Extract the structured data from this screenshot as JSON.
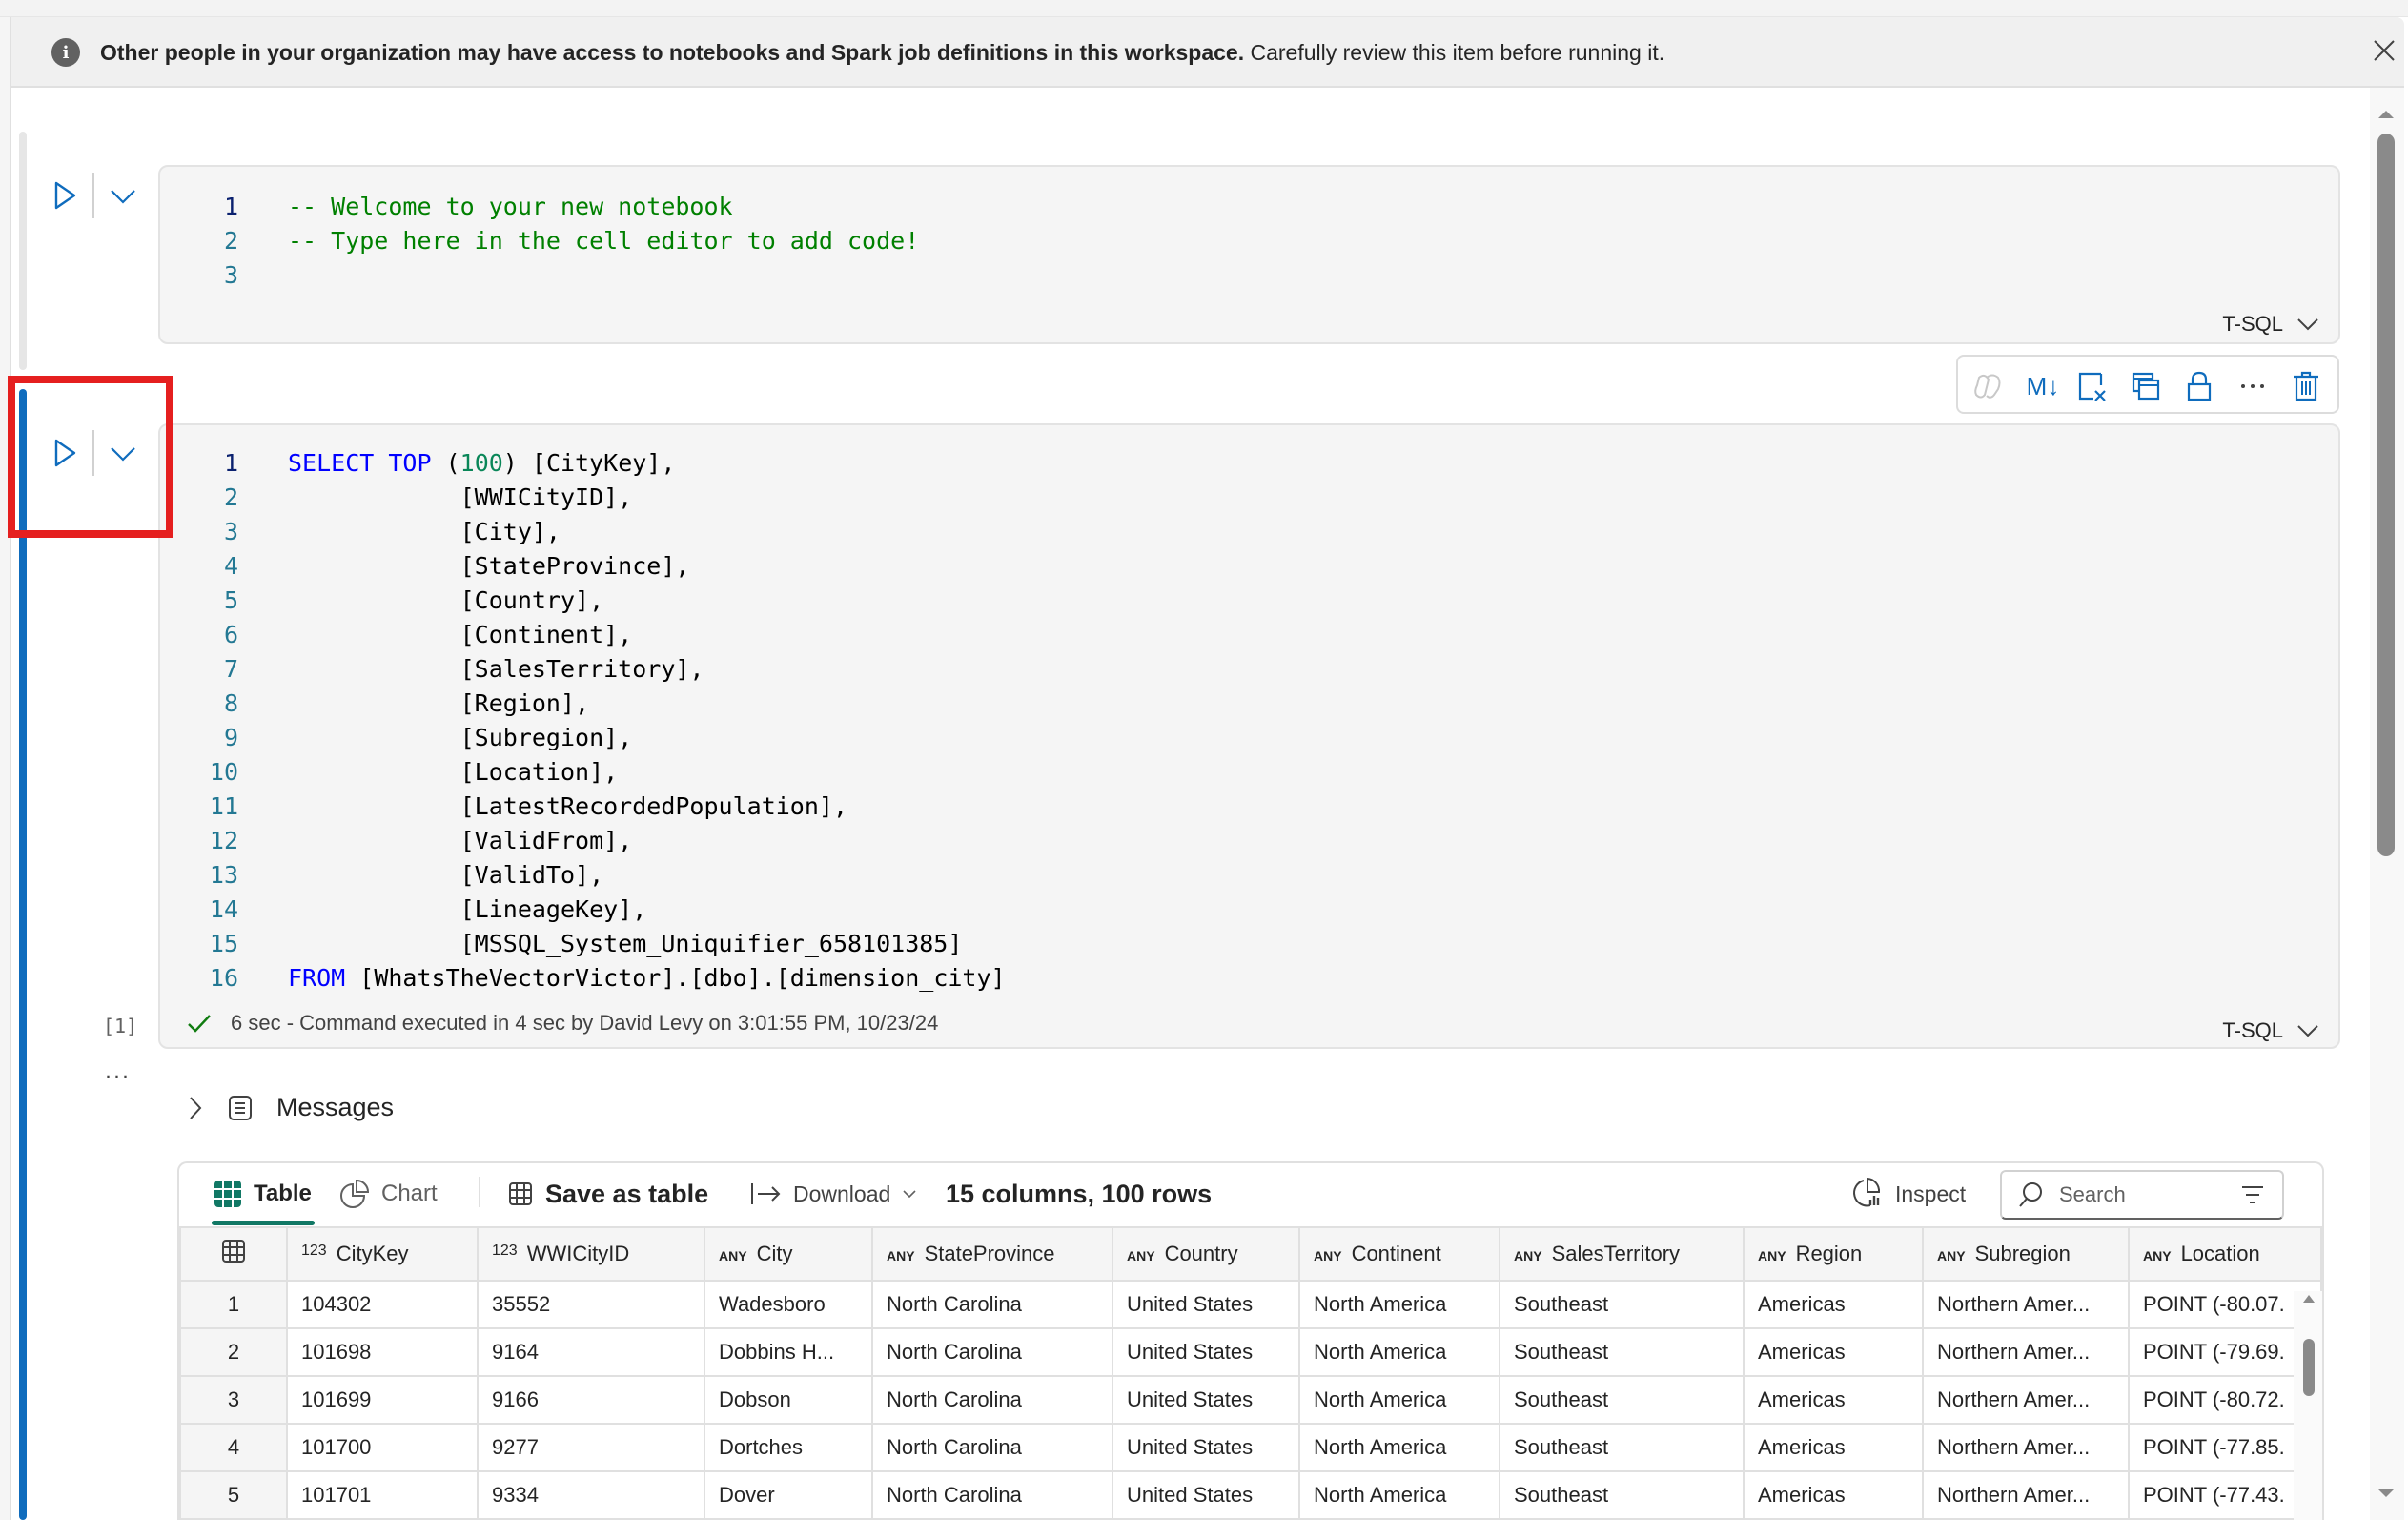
{
  "banner": {
    "bold_text": "Other people in your organization may have access to notebooks and Spark job definitions in this workspace.",
    "normal_text": " Carefully review this item before running it.",
    "icon": "info-icon",
    "close_icon": "close-icon"
  },
  "cells": [
    {
      "language": "T-SQL",
      "lines": [
        {
          "n": "1",
          "tokens": [
            {
              "t": "-- Welcome to your new notebook",
              "c": "comment"
            }
          ]
        },
        {
          "n": "2",
          "tokens": [
            {
              "t": "-- Type here in the cell editor to add code!",
              "c": "comment"
            }
          ]
        },
        {
          "n": "3",
          "tokens": []
        }
      ]
    },
    {
      "language": "T-SQL",
      "execution_count": "[1]",
      "status_text": "6 sec - Command executed in 4 sec by David Levy on 3:01:55 PM, 10/23/24",
      "lines": [
        {
          "n": "1",
          "tokens": [
            {
              "t": "SELECT",
              "c": "kw"
            },
            {
              "t": " "
            },
            {
              "t": "TOP",
              "c": "kw"
            },
            {
              "t": " ("
            },
            {
              "t": "100",
              "c": "num"
            },
            {
              "t": ") [CityKey],"
            }
          ]
        },
        {
          "n": "2",
          "tokens": [
            {
              "t": "            [WWICityID],"
            }
          ]
        },
        {
          "n": "3",
          "tokens": [
            {
              "t": "            [City],"
            }
          ]
        },
        {
          "n": "4",
          "tokens": [
            {
              "t": "            [StateProvince],"
            }
          ]
        },
        {
          "n": "5",
          "tokens": [
            {
              "t": "            [Country],"
            }
          ]
        },
        {
          "n": "6",
          "tokens": [
            {
              "t": "            [Continent],"
            }
          ]
        },
        {
          "n": "7",
          "tokens": [
            {
              "t": "            [SalesTerritory],"
            }
          ]
        },
        {
          "n": "8",
          "tokens": [
            {
              "t": "            [Region],"
            }
          ]
        },
        {
          "n": "9",
          "tokens": [
            {
              "t": "            [Subregion],"
            }
          ]
        },
        {
          "n": "10",
          "tokens": [
            {
              "t": "            [Location],"
            }
          ]
        },
        {
          "n": "11",
          "tokens": [
            {
              "t": "            [LatestRecordedPopulation],"
            }
          ]
        },
        {
          "n": "12",
          "tokens": [
            {
              "t": "            [ValidFrom],"
            }
          ]
        },
        {
          "n": "13",
          "tokens": [
            {
              "t": "            [ValidTo],"
            }
          ]
        },
        {
          "n": "14",
          "tokens": [
            {
              "t": "            [LineageKey],"
            }
          ]
        },
        {
          "n": "15",
          "tokens": [
            {
              "t": "            [MSSQL_System_Uniquifier_658101385]"
            }
          ]
        },
        {
          "n": "16",
          "tokens": [
            {
              "t": "FROM",
              "c": "kw"
            },
            {
              "t": " [WhatsTheVectorVictor].[dbo].[dimension_city]"
            }
          ]
        }
      ]
    }
  ],
  "cell_toolbar": {
    "buttons": [
      {
        "name": "copilot-icon",
        "label": "Copilot",
        "enabled": false
      },
      {
        "name": "markdown-toggle-icon",
        "label": "M↓"
      },
      {
        "name": "clear-output-icon",
        "label": "Clear output"
      },
      {
        "name": "duplicate-cell-icon",
        "label": "Duplicate cell"
      },
      {
        "name": "lock-icon",
        "label": "Lock"
      },
      {
        "name": "more-options-icon",
        "label": "···"
      },
      {
        "name": "delete-icon",
        "label": "Delete"
      }
    ]
  },
  "output": {
    "more_label": "···",
    "messages_label": "Messages",
    "toolbar": {
      "table_label": "Table",
      "chart_label": "Chart",
      "save_as_table_label": "Save as table",
      "download_label": "Download",
      "summary": "15 columns, 100 rows",
      "inspect_label": "Inspect",
      "search_placeholder": "Search",
      "active_tab": "Table"
    },
    "columns": [
      {
        "type": "123",
        "name": "CityKey"
      },
      {
        "type": "ANY",
        "name": "WWICityID",
        "type_override": "123"
      },
      {
        "type": "ANY",
        "name": "City"
      },
      {
        "type": "ANY",
        "name": "StateProvince"
      },
      {
        "type": "ANY",
        "name": "Country"
      },
      {
        "type": "ANY",
        "name": "Continent"
      },
      {
        "type": "ANY",
        "name": "SalesTerritory"
      },
      {
        "type": "ANY",
        "name": "Region"
      },
      {
        "type": "ANY",
        "name": "Subregion"
      },
      {
        "type": "ANY",
        "name": "Location"
      }
    ],
    "rows": [
      [
        "1",
        "104302",
        "35552",
        "Wadesboro",
        "North Carolina",
        "United States",
        "North America",
        "Southeast",
        "Americas",
        "Northern Amer...",
        "POINT (-80.07."
      ],
      [
        "2",
        "101698",
        "9164",
        "Dobbins H...",
        "North Carolina",
        "United States",
        "North America",
        "Southeast",
        "Americas",
        "Northern Amer...",
        "POINT (-79.69."
      ],
      [
        "3",
        "101699",
        "9166",
        "Dobson",
        "North Carolina",
        "United States",
        "North America",
        "Southeast",
        "Americas",
        "Northern Amer...",
        "POINT (-80.72."
      ],
      [
        "4",
        "101700",
        "9277",
        "Dortches",
        "North Carolina",
        "United States",
        "North America",
        "Southeast",
        "Americas",
        "Northern Amer...",
        "POINT (-77.85."
      ],
      [
        "5",
        "101701",
        "9334",
        "Dover",
        "North Carolina",
        "United States",
        "North America",
        "Southeast",
        "Americas",
        "Northern Amer...",
        "POINT (-77.43."
      ]
    ]
  },
  "colors": {
    "accent_blue": "#0f6cbd",
    "table_tab_green": "#117865",
    "highlight_red": "#e51f1f",
    "success_green": "#107c10"
  }
}
